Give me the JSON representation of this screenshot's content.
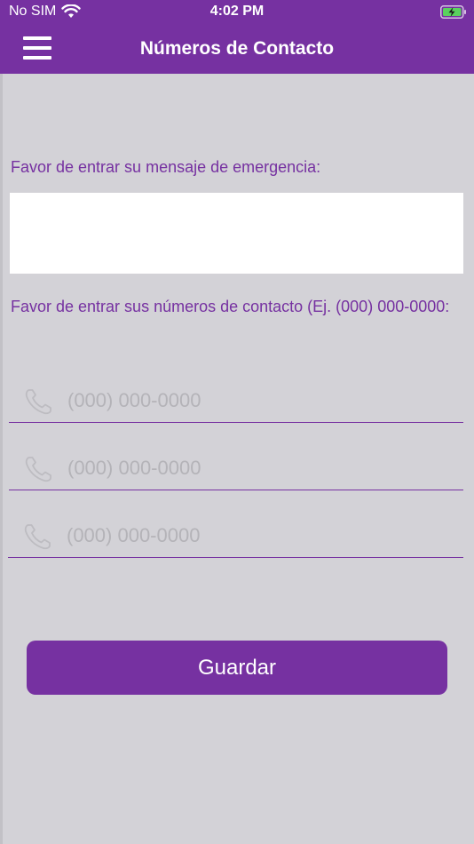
{
  "status_bar": {
    "carrier": "No SIM",
    "time": "4:02 PM"
  },
  "nav": {
    "title": "Números de Contacto"
  },
  "form": {
    "message_label": "Favor de entrar su mensaje de emergencia:",
    "message_value": "",
    "contacts_label": "Favor de entrar sus números de contacto (Ej. (000) 000-0000:",
    "phones": [
      {
        "value": "",
        "placeholder": "(000) 000-0000"
      },
      {
        "value": "",
        "placeholder": "(000) 000-0000"
      },
      {
        "value": "",
        "placeholder": "(000) 000-0000"
      }
    ],
    "save_label": "Guardar"
  },
  "colors": {
    "accent": "#7631a1",
    "background": "#d3d2d7",
    "placeholder": "#b4b3b8"
  },
  "icons": {
    "menu": "hamburger-menu-icon",
    "phone": "phone-handset-icon",
    "wifi": "wifi-icon",
    "battery": "battery-charging-icon"
  }
}
